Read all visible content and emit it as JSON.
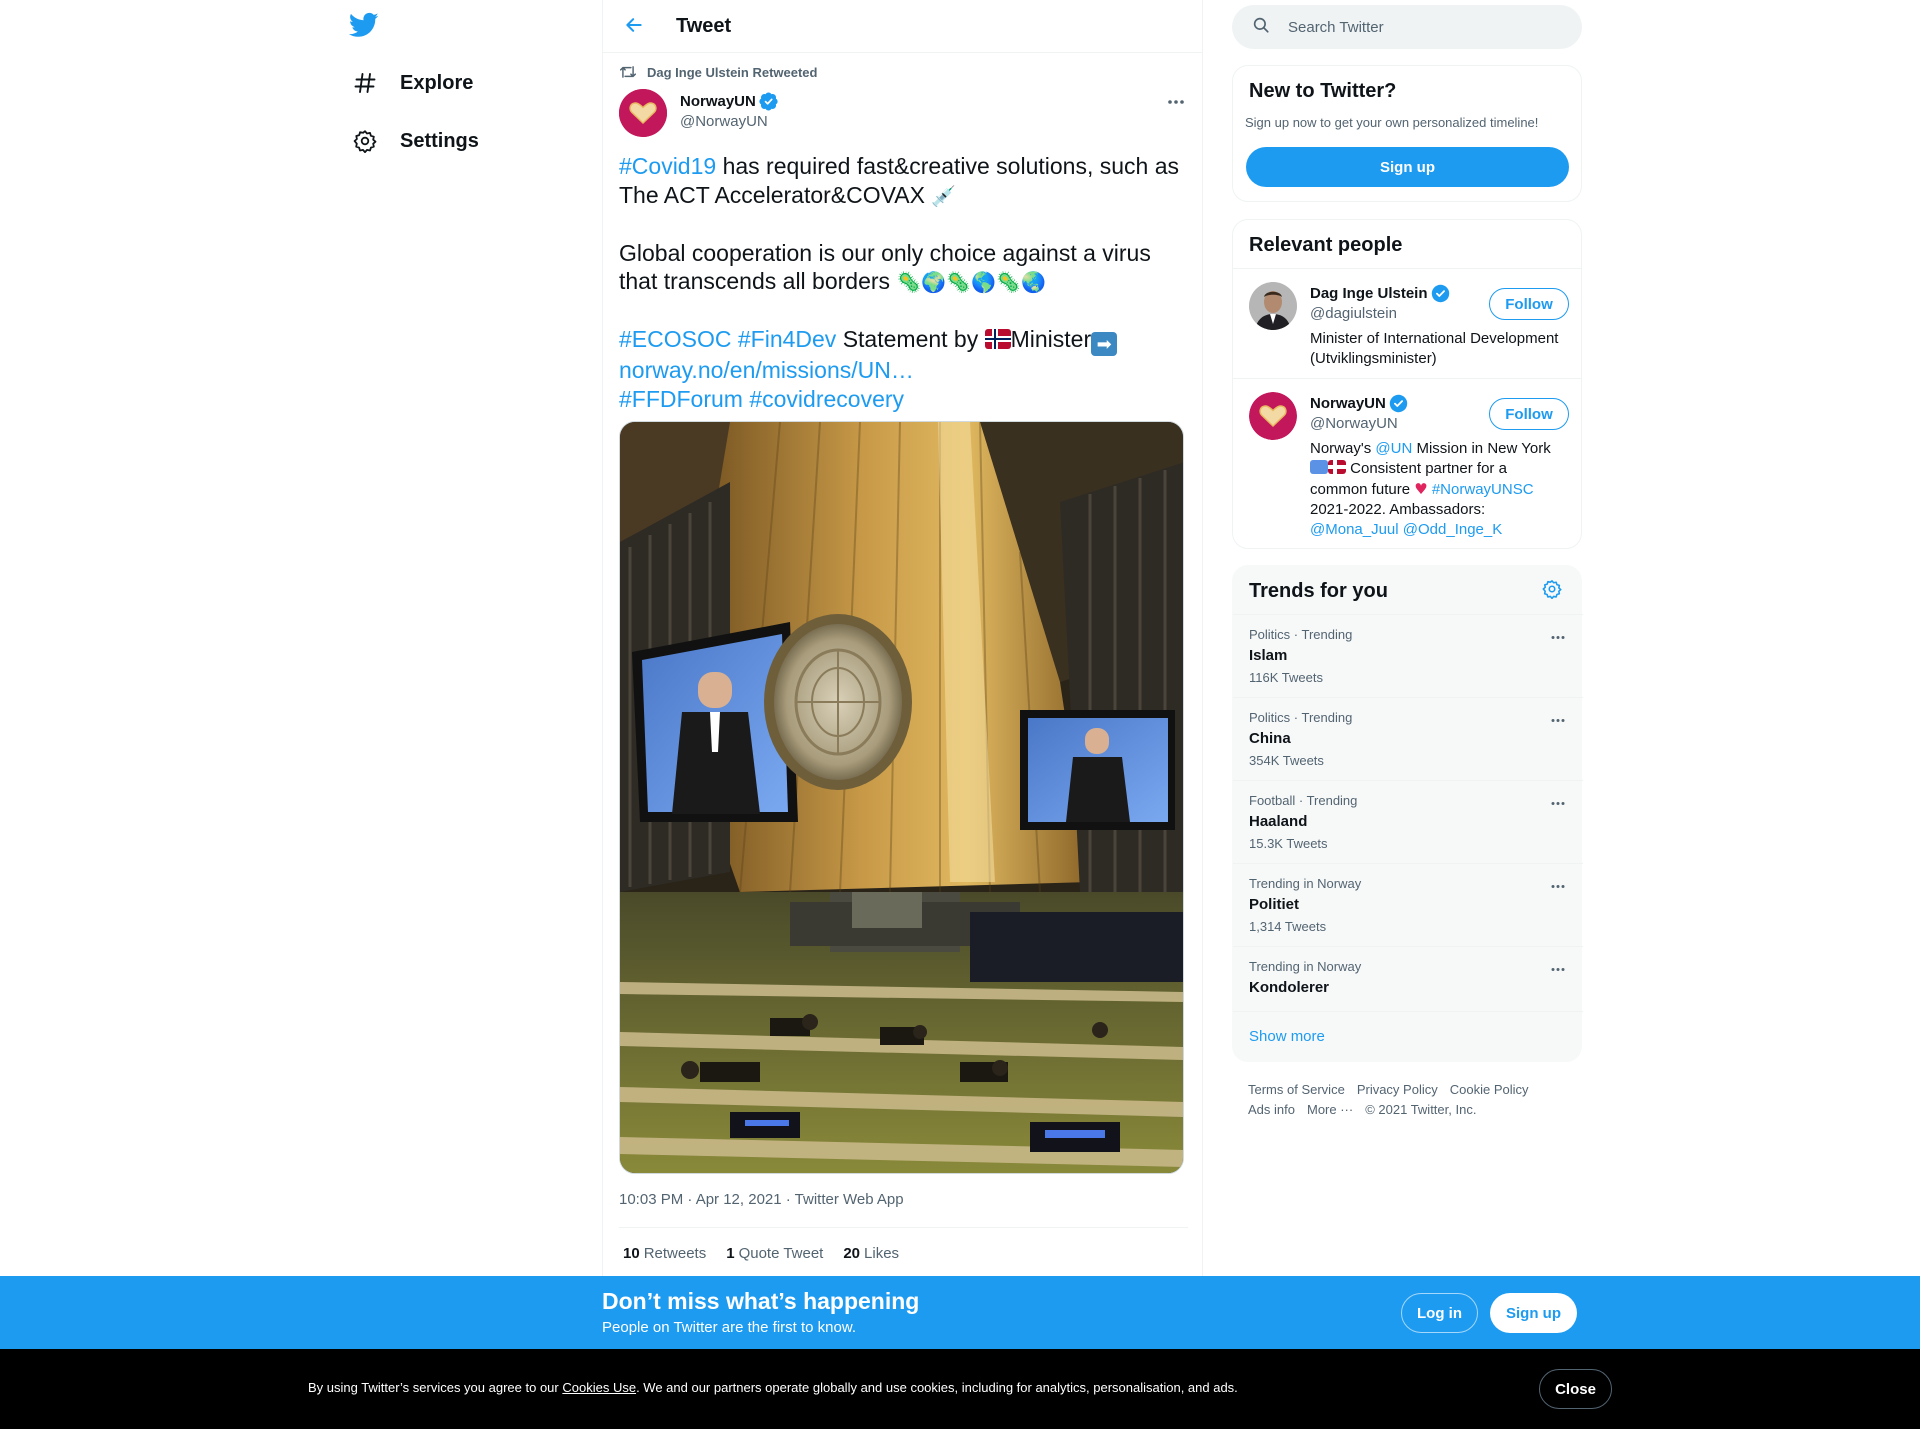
{
  "colors": {
    "accent": "#1d9bf0",
    "text_primary": "#0f1419",
    "text_secondary": "#536471",
    "cookie_bar": "#000000",
    "avatar_bg": "#c2185b"
  },
  "nav": {
    "logo_icon": "twitter-bird-icon",
    "items": [
      {
        "label": "Explore",
        "icon": "hashtag-icon"
      },
      {
        "label": "Settings",
        "icon": "gear-icon"
      }
    ]
  },
  "header": {
    "back_icon": "arrow-left-icon",
    "title": "Tweet"
  },
  "tweet": {
    "retweeted_by": "Dag Inge Ulstein Retweeted",
    "author_name": "NorwayUN",
    "author_handle": "@NorwayUN",
    "text": {
      "hashtag_covid": "#Covid19",
      "line1_rest": " has required fast&creative solutions, such as The ACT Accelerator&COVAX ",
      "syringe": "💉",
      "line2": "Global cooperation is our only choice against a virus that transcends all borders ",
      "line2_emojis": "🦠🌍🦠🌎🦠🌏",
      "hashtag_ecosoc": "#ECOSOC",
      "hashtag_fin4dev": "#Fin4Dev",
      "statement_by": " Statement by ",
      "minister": "Minister",
      "arrow": "➡",
      "url": "norway.no/en/missions/UN…",
      "hashtag_ffd": "#FFDForum",
      "hashtag_recovery": "#covidrecovery"
    },
    "timestamp": "10:03 PM · Apr 12, 2021 · Twitter Web App",
    "stats": {
      "retweets_count": "10",
      "retweets_label": "Retweets",
      "quotes_count": "1",
      "quotes_label": "Quote Tweet",
      "likes_count": "20",
      "likes_label": "Likes"
    }
  },
  "search": {
    "placeholder": "Search Twitter"
  },
  "new_to_twitter": {
    "title": "New to Twitter?",
    "subtitle": "Sign up now to get your own personalized timeline!",
    "signup_label": "Sign up"
  },
  "relevant_people": {
    "title": "Relevant people",
    "people": [
      {
        "name": "Dag Inge Ulstein",
        "handle": "@dagiulstein",
        "bio": "Minister of International Development (Utviklingsminister)",
        "follow_label": "Follow"
      },
      {
        "name": "NorwayUN",
        "handle": "@NorwayUN",
        "bio_part1": "Norway's ",
        "bio_mention_un": "@UN",
        "bio_part2": " Mission in New York ",
        "bio_part3": " Consistent partner for a common future ",
        "bio_heart": "♥",
        "bio_hashtag": "#NorwayUNSC",
        "bio_part4": " 2021-2022. Ambassadors: ",
        "bio_mention1": "@Mona_Juul",
        "bio_mention2": "@Odd_Inge_K",
        "follow_label": "Follow"
      }
    ]
  },
  "trends": {
    "title": "Trends for you",
    "items": [
      {
        "meta": "Politics · Trending",
        "name": "Islam",
        "count": "116K Tweets"
      },
      {
        "meta": "Politics · Trending",
        "name": "China",
        "count": "354K Tweets"
      },
      {
        "meta": "Football · Trending",
        "name": "Haaland",
        "count": "15.3K Tweets"
      },
      {
        "meta": "Trending in Norway",
        "name": "Politiet",
        "count": "1,314 Tweets"
      },
      {
        "meta": "Trending in Norway",
        "name": "Kondolerer",
        "count": ""
      }
    ],
    "show_more": "Show more"
  },
  "footer": {
    "links": [
      "Terms of Service",
      "Privacy Policy",
      "Cookie Policy",
      "Ads info",
      "More ···"
    ],
    "copyright": "© 2021 Twitter, Inc."
  },
  "banner": {
    "title": "Don’t miss what’s happening",
    "subtitle": "People on Twitter are the first to know.",
    "login_label": "Log in",
    "signup_label": "Sign up"
  },
  "cookie": {
    "text_before": "By using Twitter’s services you agree to our ",
    "link": "Cookies Use",
    "text_after": ". We and our partners operate globally and use cookies, including for analytics, personalisation, and ads.",
    "close_label": "Close"
  }
}
